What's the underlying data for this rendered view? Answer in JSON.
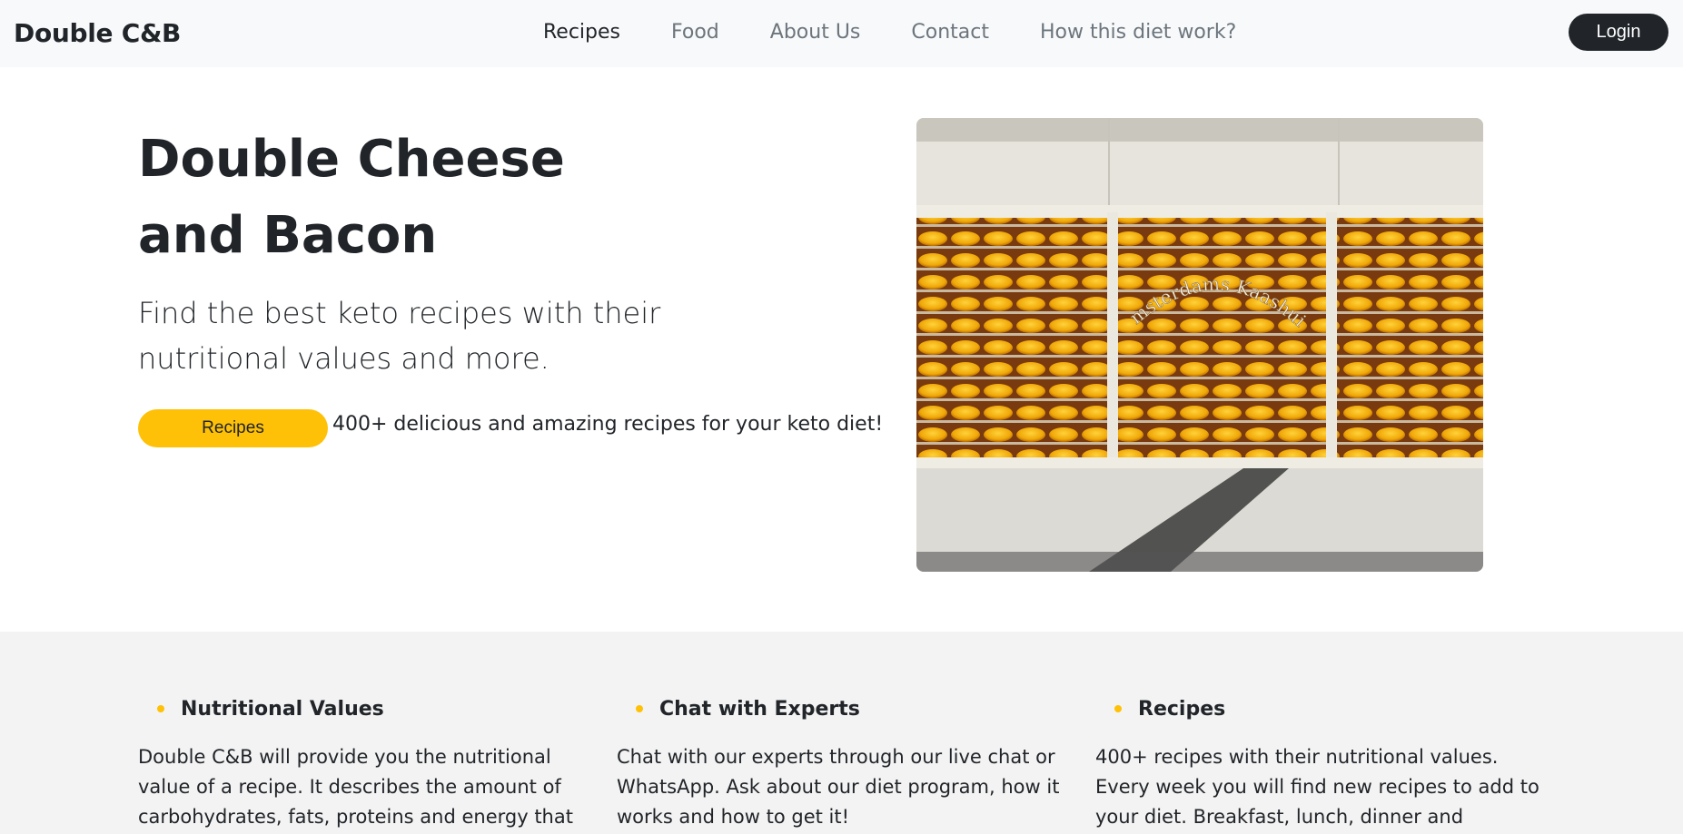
{
  "brand": "Double C&B",
  "nav": {
    "links": [
      "Recipes",
      "Food",
      "About Us",
      "Contact",
      "How this diet work?"
    ],
    "login": "Login"
  },
  "hero": {
    "title_line1": "Double Cheese",
    "title_line2": "and Bacon",
    "lead": "Find the best keto recipes with their nutritional values and more.",
    "button": "Recipes",
    "note": "400+ delicious and amazing recipes for your keto diet!",
    "image_sign": "Amsterdams Kaashuis"
  },
  "features": [
    {
      "title": "Nutritional Values",
      "text": "Double C&B will provide you the nutritional value of a recipe. It describes the amount of carbohydrates, fats, proteins and energy that can"
    },
    {
      "title": "Chat with Experts",
      "text": "Chat with our experts through our live chat or WhatsApp. Ask about our diet program, how it works and how to get it!"
    },
    {
      "title": "Recipes",
      "text": "400+ recipes with their nutritional values. Every week you will find new recipes to add to your diet. Breakfast, lunch, dinner and desserts available for"
    }
  ],
  "colors": {
    "accent": "#ffc107",
    "dark": "#212529",
    "navbar_bg": "#f8f9fa",
    "section_bg": "#f3f3f3"
  }
}
